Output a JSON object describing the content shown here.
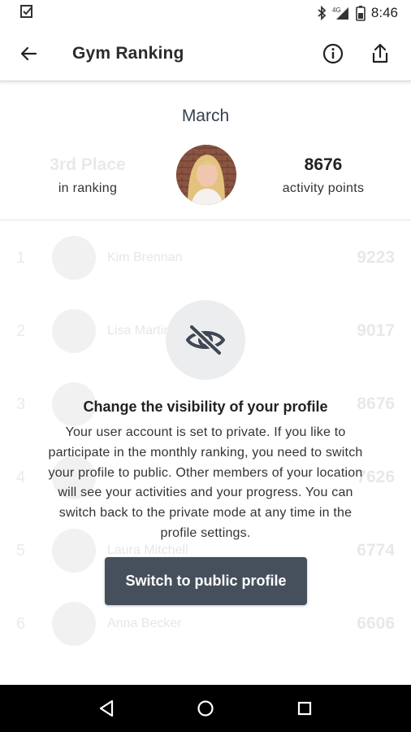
{
  "status_bar": {
    "time": "8:46",
    "network": "4G",
    "icons": [
      "task-check-icon",
      "bluetooth-icon",
      "cellular-signal-icon",
      "battery-icon"
    ]
  },
  "app_bar": {
    "title": "Gym Ranking",
    "icons": [
      "back-arrow-icon",
      "info-icon",
      "share-icon"
    ]
  },
  "header": {
    "month": "March",
    "rank_place": "3rd Place",
    "rank_label": "in ranking",
    "points_value": "8676",
    "points_label": "activity points"
  },
  "ranking": {
    "rows": [
      {
        "rank": "1",
        "name": "Kim Brennan",
        "points": "9223"
      },
      {
        "rank": "2",
        "name": "Lisa Martin",
        "points": "9017"
      },
      {
        "rank": "3",
        "name": "",
        "points": "8676"
      },
      {
        "rank": "4",
        "name": "",
        "points": "7626"
      },
      {
        "rank": "5",
        "name": "Laura Mitchell",
        "points": "6774"
      },
      {
        "rank": "6",
        "name": "Anna Becker",
        "points": "6606"
      }
    ]
  },
  "privacy_dialog": {
    "icon": "eye-off-icon",
    "title": "Change the visibility of your profile",
    "body_lines": [
      "Your user account is set to private. If you like to",
      "participate in the monthly ranking, you need to switch",
      "your profile to public. Other members of your location",
      "will see your activities and your progress. You can",
      "switch back to the private mode at any time in the",
      "profile settings."
    ],
    "button_label": "Switch to public profile"
  },
  "nav_bar": {
    "icons": [
      "nav-back-icon",
      "nav-home-icon",
      "nav-recents-icon"
    ]
  },
  "colors": {
    "primary_button": "#46505c",
    "month_text": "#364150",
    "eye_circle_bg": "#ecedee"
  }
}
